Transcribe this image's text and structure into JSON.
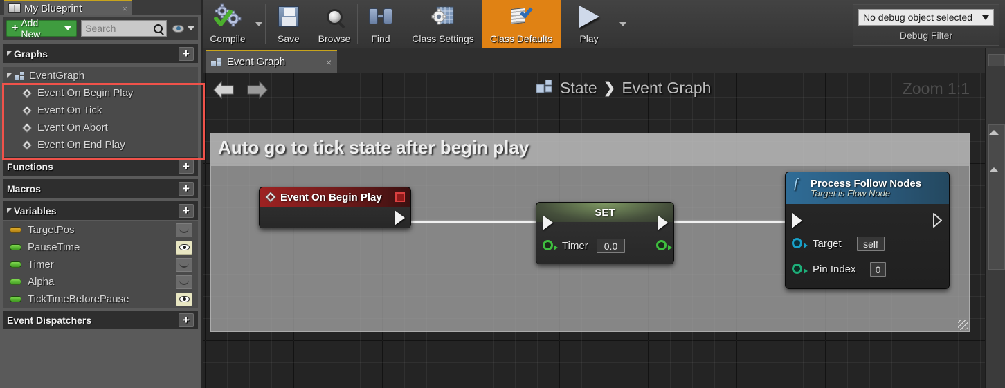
{
  "left_panel": {
    "tab": {
      "label": "My Blueprint",
      "icon": "book-icon",
      "close": "×"
    },
    "toolbar": {
      "add_new_label": "Add New",
      "add_new_plus": "+",
      "search_placeholder": "Search",
      "search_value": "",
      "search_icon": "magnifier-icon",
      "eye_icon": "eye-icon"
    },
    "sections": {
      "graphs": {
        "label": "Graphs",
        "add": "+"
      },
      "functions": {
        "label": "Functions",
        "add": "+"
      },
      "macros": {
        "label": "Macros",
        "add": "+"
      },
      "variables": {
        "label": "Variables",
        "add": "+"
      },
      "event_dispatchers": {
        "label": "Event Dispatchers",
        "add": "+"
      }
    },
    "graph_tree": {
      "root": {
        "label": "EventGraph",
        "icon": "graph-icon"
      },
      "events": [
        {
          "label": "Event On Begin Play",
          "icon": "event-diamond-icon"
        },
        {
          "label": "Event On Tick",
          "icon": "event-diamond-icon"
        },
        {
          "label": "Event On Abort",
          "icon": "event-diamond-icon"
        },
        {
          "label": "Event On End Play",
          "icon": "event-diamond-icon"
        }
      ],
      "highlight_color": "#f0524a"
    },
    "variables": [
      {
        "name": "TargetPos",
        "pin_color": "#d79a1a",
        "visible": false
      },
      {
        "name": "PauseTime",
        "pin_color": "#56c23a",
        "visible": true
      },
      {
        "name": "Timer",
        "pin_color": "#56c23a",
        "visible": false
      },
      {
        "name": "Alpha",
        "pin_color": "#56c23a",
        "visible": false
      },
      {
        "name": "TickTimeBeforePause",
        "pin_color": "#56c23a",
        "visible": true
      }
    ]
  },
  "toolbar": {
    "items": [
      {
        "label": "Compile",
        "icon": "compile-gear-check-icon",
        "has_dropdown": true,
        "active": false
      },
      {
        "label": "Save",
        "icon": "floppy-disk-icon",
        "has_dropdown": false,
        "active": false
      },
      {
        "label": "Browse",
        "icon": "magnifier-sphere-icon",
        "has_dropdown": false,
        "active": false
      },
      {
        "label": "Find",
        "icon": "binoculars-icon",
        "has_dropdown": false,
        "active": false
      },
      {
        "label": "Class Settings",
        "icon": "class-settings-icon",
        "has_dropdown": false,
        "active": false
      },
      {
        "label": "Class Defaults",
        "icon": "class-defaults-icon",
        "has_dropdown": false,
        "active": true
      },
      {
        "label": "Play",
        "icon": "play-triangle-icon",
        "has_dropdown": true,
        "active": false
      }
    ],
    "active_color": "#e08214",
    "debug": {
      "selected": "No debug object selected",
      "filter_label": "Debug Filter",
      "caret_icon": "chevron-down-icon"
    }
  },
  "graph_tab": {
    "label": "Event Graph",
    "icon": "graph-icon",
    "close": "×"
  },
  "canvas": {
    "nav": {
      "back_icon": "arrow-left-icon",
      "forward_icon": "arrow-right-icon"
    },
    "breadcrumb": {
      "icon": "graph-icon",
      "root": "State",
      "separator": "❯",
      "current": "Event Graph"
    },
    "zoom_label": "Zoom 1:1",
    "comment": {
      "text": "Auto go to tick state after begin play",
      "resize_icon": "resize-grip-icon"
    },
    "nodes": [
      {
        "id": "event_begin_play",
        "title": "Event On Begin Play",
        "icon": "event-diamond-icon",
        "badge_icon": "red-square-icon",
        "header_color": "#8a1d1d",
        "exec_out": "exec-out-pin"
      },
      {
        "id": "set_timer",
        "title": "SET",
        "header_color": "#5c6b4e",
        "exec_in": "exec-in-pin",
        "exec_out": "exec-out-pin",
        "pins": [
          {
            "label": "Timer",
            "value": "0.0",
            "color": "#3fbf3f",
            "side": "in"
          },
          {
            "label": "",
            "value": "",
            "color": "#3fbf3f",
            "side": "out"
          }
        ]
      },
      {
        "id": "process_follow_nodes",
        "title": "Process Follow Nodes",
        "subtitle": "Target is Flow Node",
        "icon": "function-f-icon",
        "header_color": "#2f6c96",
        "exec_in": "exec-in-pin",
        "exec_out": "exec-out-pin",
        "pins": [
          {
            "label": "Target",
            "value": "self",
            "color": "#18a0c8",
            "side": "in"
          },
          {
            "label": "Pin Index",
            "value": "0",
            "color": "#1eb07a",
            "side": "in"
          }
        ]
      }
    ]
  }
}
